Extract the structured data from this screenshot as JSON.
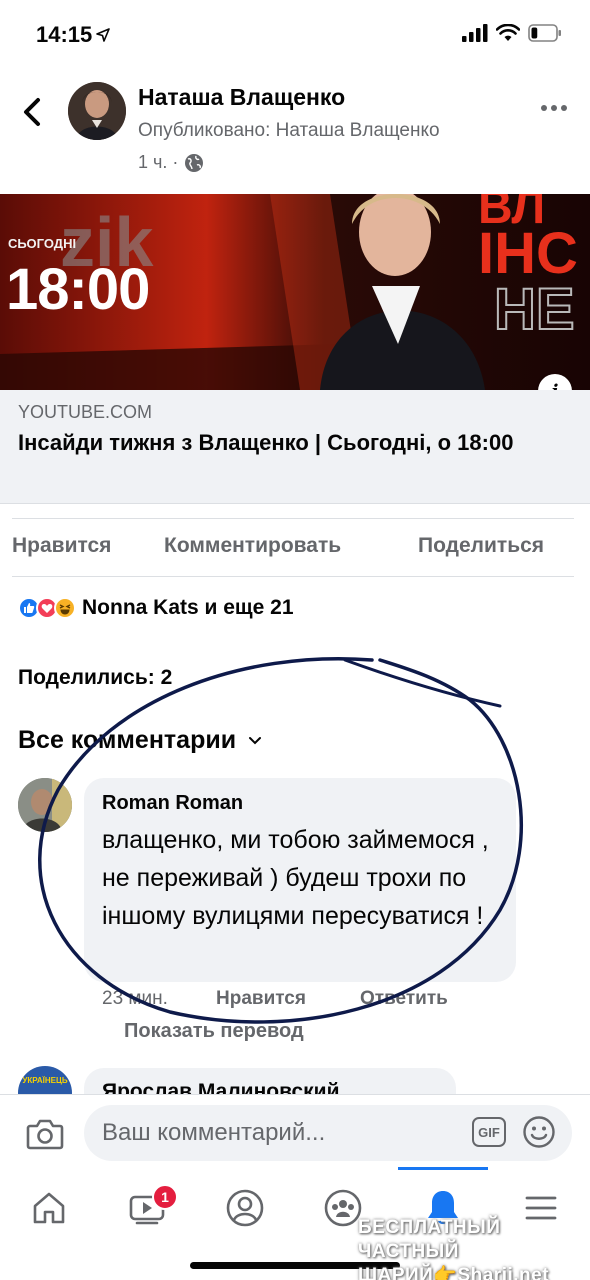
{
  "status_bar": {
    "time": "14:15",
    "location_icon": "location-arrow-icon",
    "signal_icon": "cellular-signal-icon",
    "wifi_icon": "wifi-icon",
    "battery_icon": "battery-icon",
    "battery_level": 0.25
  },
  "post": {
    "author": "Наташа Влащенко",
    "published_by": "Опубликовано: Наташа Влащенко",
    "time": "1 ч. ·",
    "privacy_icon": "globe-icon",
    "link": {
      "thumbnail": {
        "today": "СЬОГОДНІ",
        "time": "18:00",
        "logo": "zik",
        "side_text_top": "ВЛ",
        "side_text_mid": "ІНС",
        "side_text_bottom": "НЕ"
      },
      "domain": "YOUTUBE.COM",
      "title": "Інсайди тижня з Влащенко | Сьогодні, о 18:00"
    },
    "actions": {
      "like": "Нравится",
      "comment": "Комментировать",
      "share": "Поделиться"
    },
    "reactions": {
      "icons": [
        "like-icon",
        "love-icon",
        "haha-icon"
      ],
      "label": "Nonna Kats и еще 21"
    },
    "shares": "Поделились: 2"
  },
  "comments": {
    "filter_label": "Все комментарии",
    "items": [
      {
        "author": "Roman Roman",
        "text": "влащенко, ми тобою займемося , не переживай ) будеш трохи по іншому вулицями пересуватися !",
        "time": "23 мин.",
        "like": "Нравится",
        "reply": "Ответить",
        "translate": "Показать перевод"
      },
      {
        "author": "Ярослав Малиновский",
        "avatar_text": "УКРАЇНЕЦЬ"
      }
    ]
  },
  "composer": {
    "placeholder": "Ваш комментарий...",
    "gif_label": "GIF"
  },
  "tabbar": {
    "items": [
      "home-icon",
      "video-icon",
      "profile-icon",
      "groups-icon",
      "notifications-icon",
      "menu-icon"
    ],
    "active": "notifications-icon",
    "video_badge": "1"
  },
  "watermark": {
    "line1": "БЕСПЛАТНЫЙ ЧАСТНЫЙ",
    "line2": "ШАРИЙ👉Sharij.net"
  },
  "colors": {
    "accent": "#1877f2",
    "secondary_text": "#65676b",
    "bubble_bg": "#f0f2f5",
    "annotation_ink": "#0e1a4a",
    "badge": "#e41e3f"
  }
}
